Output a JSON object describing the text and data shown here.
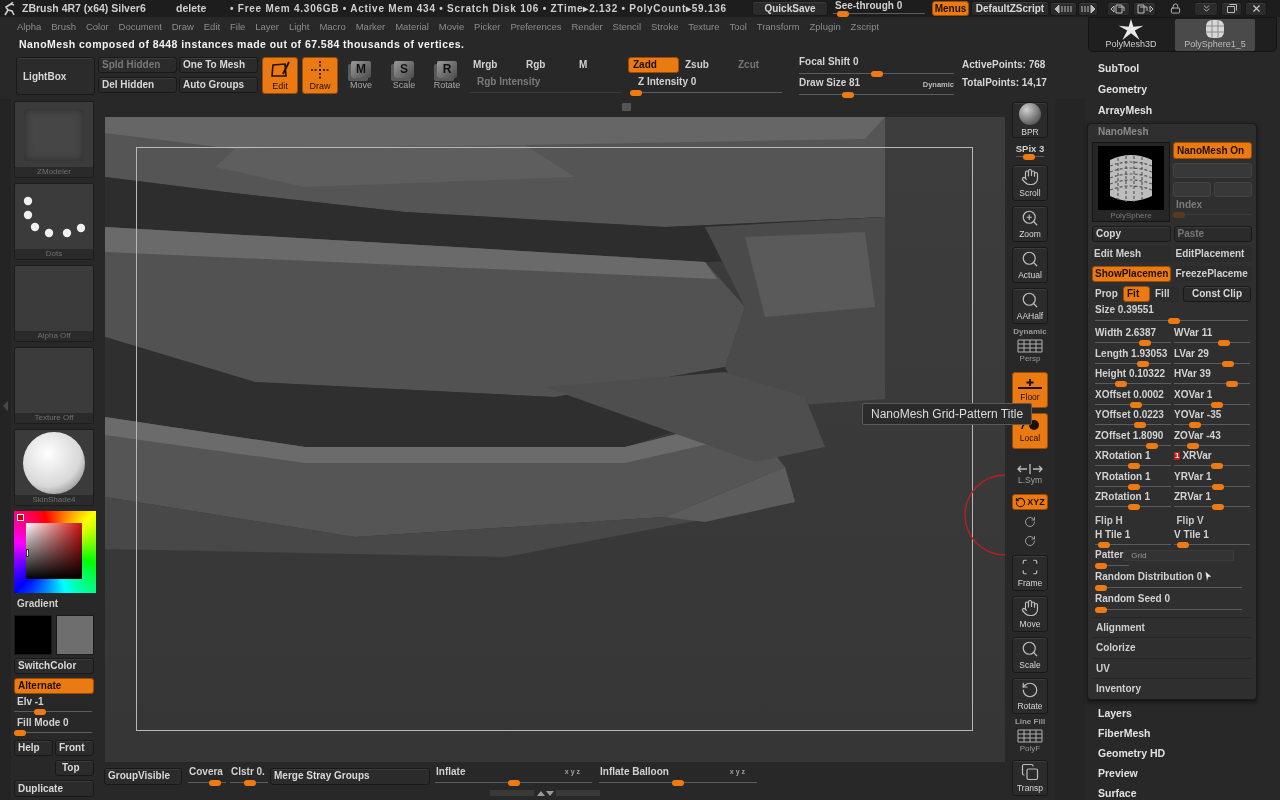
{
  "title_bar": {
    "title": "ZBrush 4R7 (x64) Silver6",
    "last_action": "delete",
    "stats": "• Free Mem 4.306GB • Active Mem 434 • Scratch Disk 106 • ZTime▸2.132 • PolyCount▸59.136",
    "quicksave": "QuickSave",
    "see_through": {
      "label": "See-through  0",
      "level": 0.05
    },
    "menus": {
      "label": "Menus",
      "on": true
    },
    "script": "DefaultZScript"
  },
  "menu_bar": [
    "Alpha",
    "Brush",
    "Color",
    "Document",
    "Draw",
    "Edit",
    "File",
    "Layer",
    "Light",
    "Macro",
    "Marker",
    "Material",
    "Movie",
    "Picker",
    "Preferences",
    "Render",
    "Stencil",
    "Stroke",
    "Texture",
    "Tool",
    "Transform",
    "Zplugin",
    "Zscript"
  ],
  "message": "NanoMesh composed of 8448 instances made out of 67.584 thousands of vertices.",
  "top_shelf": {
    "lightbox": "LightBox",
    "mesh_buttons": [
      {
        "label": "Spld Hidden",
        "disabled": true
      },
      {
        "label": "Del Hidden",
        "disabled": false
      },
      {
        "label": "One To Mesh",
        "disabled": false
      },
      {
        "label": "Auto Groups",
        "disabled": false
      }
    ],
    "transform_modes": [
      {
        "kind": "edit",
        "label": "Edit",
        "on": true
      },
      {
        "kind": "draw",
        "label": "Draw",
        "on": true
      },
      {
        "kind": "letter",
        "label": "Move",
        "letter": "M",
        "on": false
      },
      {
        "kind": "letter",
        "label": "Scale",
        "letter": "S",
        "on": false
      },
      {
        "kind": "letter",
        "label": "Rotate",
        "letter": "R",
        "on": false
      }
    ],
    "channel_modes": [
      {
        "label": "Mrgb",
        "on": false,
        "disabled": false
      },
      {
        "label": "Rgb",
        "on": false,
        "disabled": false
      },
      {
        "label": "M",
        "on": false,
        "disabled": false
      },
      {
        "label": "Zadd",
        "on": true,
        "disabled": false
      },
      {
        "label": "Zsub",
        "on": false,
        "disabled": false
      },
      {
        "label": "Zcut",
        "on": false,
        "disabled": true
      }
    ],
    "intensity": [
      {
        "label": "Rgb Intensity",
        "disabled": true
      },
      {
        "label": "Z Intensity 0",
        "disabled": false,
        "level": 0
      }
    ],
    "focal_shift": {
      "label": "Focal Shift 0",
      "level": 0.5
    },
    "draw_size": {
      "label": "Draw Size 81",
      "level": 0.3,
      "mode": "Dynamic"
    },
    "points": [
      "ActivePoints: 768",
      "TotalPoints: 14,17"
    ]
  },
  "left_panel": {
    "thumbnails": [
      {
        "kind": "brush",
        "label": "ZModeler"
      },
      {
        "kind": "stroke",
        "label": "Dots"
      },
      {
        "kind": "alpha",
        "label": "Alpha Off"
      },
      {
        "kind": "texture",
        "label": "Texture Off"
      },
      {
        "kind": "material",
        "label": "SkinShade4"
      }
    ],
    "gradient": "Gradient",
    "swatches": [
      {
        "color": "#000000"
      },
      {
        "color": "#6e6e6e"
      }
    ],
    "switch_color": "SwitchColor",
    "alternate": {
      "label": "Alternate",
      "on": true
    },
    "sliders": [
      {
        "label": "Elv -1",
        "level": 0.3
      },
      {
        "label": "Fill Mode 0",
        "level": 0
      }
    ],
    "view_buttons": [
      "Help",
      "Front",
      "Top"
    ],
    "duplicate": "Duplicate"
  },
  "viewport": {
    "tooltip": "NanoMesh Grid-Pattern Title"
  },
  "right_shelf": [
    {
      "kind": "bpr",
      "label": "BPR",
      "on": false
    },
    {
      "kind": "slider",
      "label": "SPix 3",
      "level": 0.45
    },
    {
      "kind": "hand",
      "label": "Scroll",
      "on": false
    },
    {
      "kind": "zoom",
      "label": "Zoom",
      "on": false
    },
    {
      "kind": "magnifier",
      "label": "Actual",
      "on": false
    },
    {
      "kind": "magnifier",
      "label": "AAHalf",
      "on": false
    },
    {
      "kind": "grid",
      "label": "Persp",
      "top_label": "Dynamic",
      "on": false
    },
    {
      "kind": "floor",
      "label": "Floor",
      "on": true
    },
    {
      "kind": "local",
      "label": "Local",
      "on": true
    },
    {
      "kind": "symmetry",
      "label": "L.Sym",
      "on": false
    },
    {
      "kind": "axis",
      "label": "XYZ",
      "on": true
    },
    {
      "kind": "rotate_small",
      "on": false
    },
    {
      "kind": "rotate_small",
      "on": false
    },
    {
      "kind": "frame",
      "label": "Frame",
      "on": false
    },
    {
      "kind": "hand",
      "label": "Move",
      "on": false
    },
    {
      "kind": "magnifier",
      "label": "Scale",
      "on": false
    },
    {
      "kind": "rotate",
      "label": "Rotate",
      "on": false
    },
    {
      "kind": "grid",
      "label": "PolyF",
      "top_label": "Line Fill",
      "on": false
    },
    {
      "kind": "transparency",
      "label": "Transp",
      "on": false
    }
  ],
  "bottom_bar": [
    {
      "kind": "button",
      "label": "GroupVisible"
    },
    {
      "kind": "slider",
      "label": "Covera",
      "level": 0.8
    },
    {
      "kind": "slider",
      "label": "Clstr 0.",
      "level": 0.55
    },
    {
      "kind": "button",
      "label": "Merge Stray Groups"
    },
    {
      "kind": "slider",
      "label": "Inflate",
      "axes": "x y z",
      "level": 0.5
    },
    {
      "kind": "slider",
      "label": "Inflate Balloon",
      "axes": "x y z",
      "level": 0.5
    }
  ],
  "right_panel": {
    "tools": [
      {
        "kind": "star",
        "label": "PolyMesh3D",
        "selected": false
      },
      {
        "kind": "sphere",
        "label": "PolySphere1_5",
        "selected": true
      }
    ],
    "sections_top": [
      "SubTool",
      "Geometry",
      "ArrayMesh"
    ],
    "nanomesh": {
      "title": "NanoMesh",
      "preview_label": "PolySphere",
      "nanomesh_on": {
        "label": "NanoMesh On",
        "on": true
      },
      "index": {
        "label": "Index",
        "disabled": true,
        "level": 0
      },
      "actions": [
        {
          "label": "Copy",
          "disabled": false
        },
        {
          "label": "Paste",
          "disabled": true
        }
      ],
      "edit_row": [
        {
          "label": "Edit Mesh",
          "on": false
        },
        {
          "label": "EditPlacement",
          "on": false
        }
      ],
      "placement_row": [
        {
          "label": "ShowPlacemen",
          "on": true
        },
        {
          "label": "FreezePlaceme",
          "on": false
        }
      ],
      "fit_modes": [
        {
          "label": "Prop",
          "selected": false
        },
        {
          "label": "Fit",
          "selected": true
        },
        {
          "label": "Fill",
          "selected": false
        }
      ],
      "const_clip": {
        "label": "Const Clip",
        "on": false
      },
      "size": {
        "label": "Size 0.39551",
        "level": 0.52
      },
      "slider_pairs": [
        [
          {
            "label": "Width 2.6387",
            "level": 0.69
          },
          {
            "label": "WVar 11",
            "level": 0.68
          }
        ],
        [
          {
            "label": "Length 1.93053",
            "level": 0.65
          },
          {
            "label": "LVar 29",
            "level": 0.75
          }
        ],
        [
          {
            "label": "Height 0.10322",
            "level": 0.31
          },
          {
            "label": "HVar 39",
            "level": 0.81
          }
        ],
        [
          {
            "label": "XOffset 0.0002",
            "level": 0.55
          },
          {
            "label": "XOVar 1",
            "level": 0.58
          }
        ],
        [
          {
            "label": "YOffset 0.0223",
            "level": 0.61
          },
          {
            "label": "YOVar -35",
            "level": 0.23
          }
        ],
        [
          {
            "label": "ZOffset 1.8090",
            "level": 0.8
          },
          {
            "label": "ZOVar -43",
            "level": 0.2
          }
        ],
        [
          {
            "label": "XRotation 1",
            "level": 0.51
          },
          {
            "label": "XRVar",
            "marker": "1",
            "level": 0.58
          }
        ],
        [
          {
            "label": "YRotation 1",
            "level": 0.51
          },
          {
            "label": "YRVar 1",
            "level": 0.59
          }
        ],
        [
          {
            "label": "ZRotation 1",
            "level": 0.51
          },
          {
            "label": "ZRVar 1",
            "level": 0.59
          }
        ]
      ],
      "flip": [
        {
          "label": "Flip H",
          "on": false
        },
        {
          "label": "Flip V",
          "on": false
        }
      ],
      "tiles": [
        {
          "label": "H Tile 1",
          "level": 0.04
        },
        {
          "label": "V Tile 1",
          "level": 0.05
        }
      ],
      "pattern": {
        "label": "Patter",
        "popup": "Grid",
        "level": 0
      },
      "random_sliders": [
        {
          "label": "Random Distribution 0",
          "level": 0
        },
        {
          "label": "Random Seed 0",
          "level": 0
        }
      ],
      "subsections": [
        "Alignment",
        "Colorize",
        "UV",
        "Inventory"
      ]
    },
    "sections_bottom": [
      "Layers",
      "FiberMesh",
      "Geometry HD",
      "Preview",
      "Surface"
    ]
  }
}
